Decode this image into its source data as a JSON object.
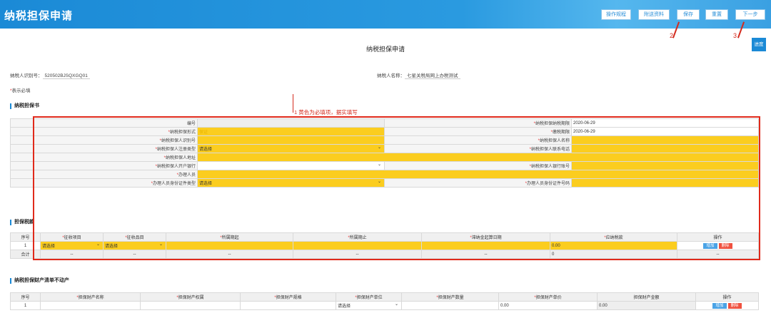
{
  "header": {
    "title": "纳税担保申请",
    "buttons": [
      "操作规程",
      "附送资料",
      "保存",
      "重置",
      "下一步"
    ]
  },
  "page_title": "纳税担保申请",
  "progress_label": "进度",
  "annotations": {
    "a1": "1 黄色为必填项，据实填写",
    "a2": "2",
    "a3": "3"
  },
  "taxpayer": {
    "id_label": "纳税人识别号：",
    "id_value": "520502BJSQXGQ01",
    "name_label": "纳税人名称：",
    "name_value": "七星关税局网上办税测试"
  },
  "required_note": "表示必填",
  "section_book": "纳税担保书",
  "book": {
    "bh": "编号",
    "qx_label": "纳税担保纳税期限",
    "qx_value": "2020-06-29",
    "xs_label": "纳税担保形式",
    "xs_value": "保证",
    "qx2_label": "缴税期限",
    "qx2_value": "2020-06-29",
    "sbh_label": "纳税担保人识别号",
    "mc_label": "纳税担保人名称",
    "zclx_label": "纳税担保人注册类型",
    "zclx_value": "请选择",
    "dh_label": "纳税担保人联系电话",
    "dz_label": "纳税担保人地址",
    "khyh_label": "纳税担保人开户银行",
    "zh_label": "纳税担保人银行账号",
    "blr_label": "办理人员",
    "zjlx_label": "办理人员身份证件类型",
    "zjlx_value": "请选择",
    "zjhm_label": "办理人员身份证件号码"
  },
  "section_tax": "担保税款",
  "tax": {
    "headers": [
      "序号",
      "征收项目",
      "征收品目",
      "所属期起",
      "所属期止",
      "滞纳金起算日期",
      "应纳税款",
      "操作"
    ],
    "row_no": "1",
    "select1": "请选择",
    "select2": "请选择",
    "amount": "0.00",
    "add": "增加",
    "del": "删除",
    "total_label": "合计",
    "dash": "--",
    "total_amount": "0"
  },
  "section_property": "纳税担保财产清单不动产",
  "property": {
    "headers": [
      "序号",
      "担保财产名称",
      "担保财产权属",
      "担保财产规格",
      "担保财产单位",
      "担保财产数量",
      "担保财产单价",
      "担保财产金额",
      "操作"
    ],
    "row_no": "1",
    "unit": "请选择",
    "price": "0.00",
    "amount": "0.00",
    "add": "增加",
    "del": "删除"
  }
}
